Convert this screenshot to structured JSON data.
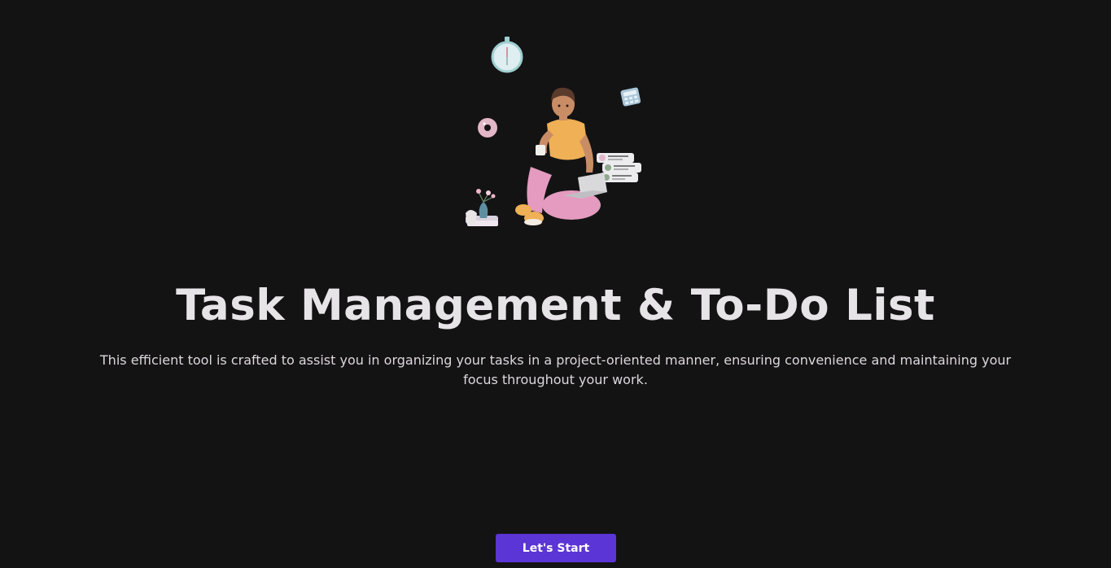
{
  "hero": {
    "illustration_name": "person-with-laptop-illustration",
    "colors": {
      "skin": "#c98d66",
      "hair": "#5a3b2c",
      "shirt": "#efb056",
      "pants": "#e49bbf",
      "laptop": "#d9d9dc",
      "clock_ring": "#9fcfd0",
      "vase": "#5d8fa1",
      "donut": "#e3b6c8"
    }
  },
  "title": "Task Management & To-Do List",
  "subtitle": "This efficient tool is crafted to assist you in organizing your tasks in a project-oriented manner, ensuring convenience and maintaining your focus throughout your work.",
  "cta": {
    "label": "Let's Start",
    "color": "#5b35d5"
  },
  "theme": {
    "background": "#141314",
    "text": "#e7e4e7"
  }
}
